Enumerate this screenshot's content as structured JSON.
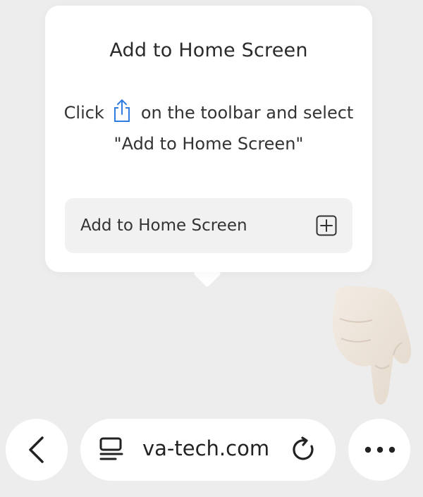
{
  "popup": {
    "title": "Add to Home Screen",
    "instruction_prefix": "Click",
    "instruction_suffix": "on the toolbar and select",
    "instruction_line2": "\"Add to Home Screen\"",
    "action_label": "Add to Home Screen",
    "share_icon": "share-icon",
    "action_icon": "plus-square-icon"
  },
  "toolbar": {
    "back_icon": "chevron-left-icon",
    "tabs_icon": "reader-tabs-icon",
    "url": "va-tech.com",
    "reload_icon": "reload-icon",
    "more_icon": "more-dots-icon"
  },
  "overlay": {
    "hint_icon": "pointing-hand-icon"
  },
  "colors": {
    "accent": "#2f7de1",
    "background": "#ededed",
    "card": "#ffffff"
  }
}
